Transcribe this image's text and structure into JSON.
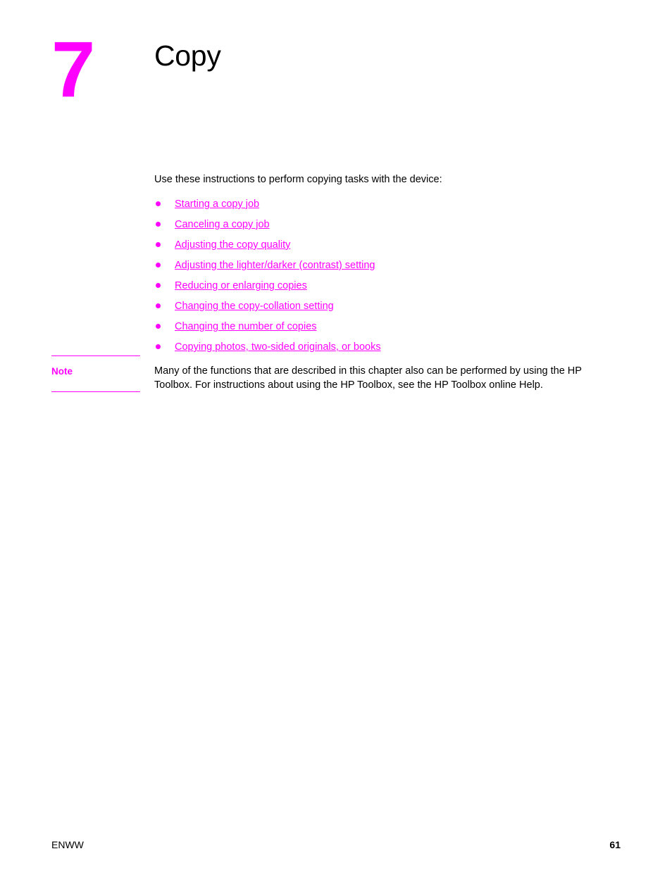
{
  "chapter": {
    "number": "7",
    "title": "Copy",
    "number_color": "#ff00ff"
  },
  "intro": {
    "text": "Use these instructions to perform copying tasks with the device:"
  },
  "links": [
    {
      "label": "Starting a copy job"
    },
    {
      "label": "Canceling a copy job"
    },
    {
      "label": "Adjusting the copy quality"
    },
    {
      "label": "Adjusting the lighter/darker (contrast) setting"
    },
    {
      "label": "Reducing or enlarging copies"
    },
    {
      "label": "Changing the copy-collation setting"
    },
    {
      "label": "Changing the number of copies"
    },
    {
      "label": "Copying photos, two-sided originals, or books"
    }
  ],
  "note": {
    "label": "Note",
    "body": "Many of the functions that are described in this chapter also can be performed by using the HP Toolbox. For instructions about using the HP Toolbox, see the HP Toolbox online Help.",
    "accent_color": "#ff00ff"
  },
  "footer": {
    "left": "ENWW",
    "page_number": "61"
  }
}
